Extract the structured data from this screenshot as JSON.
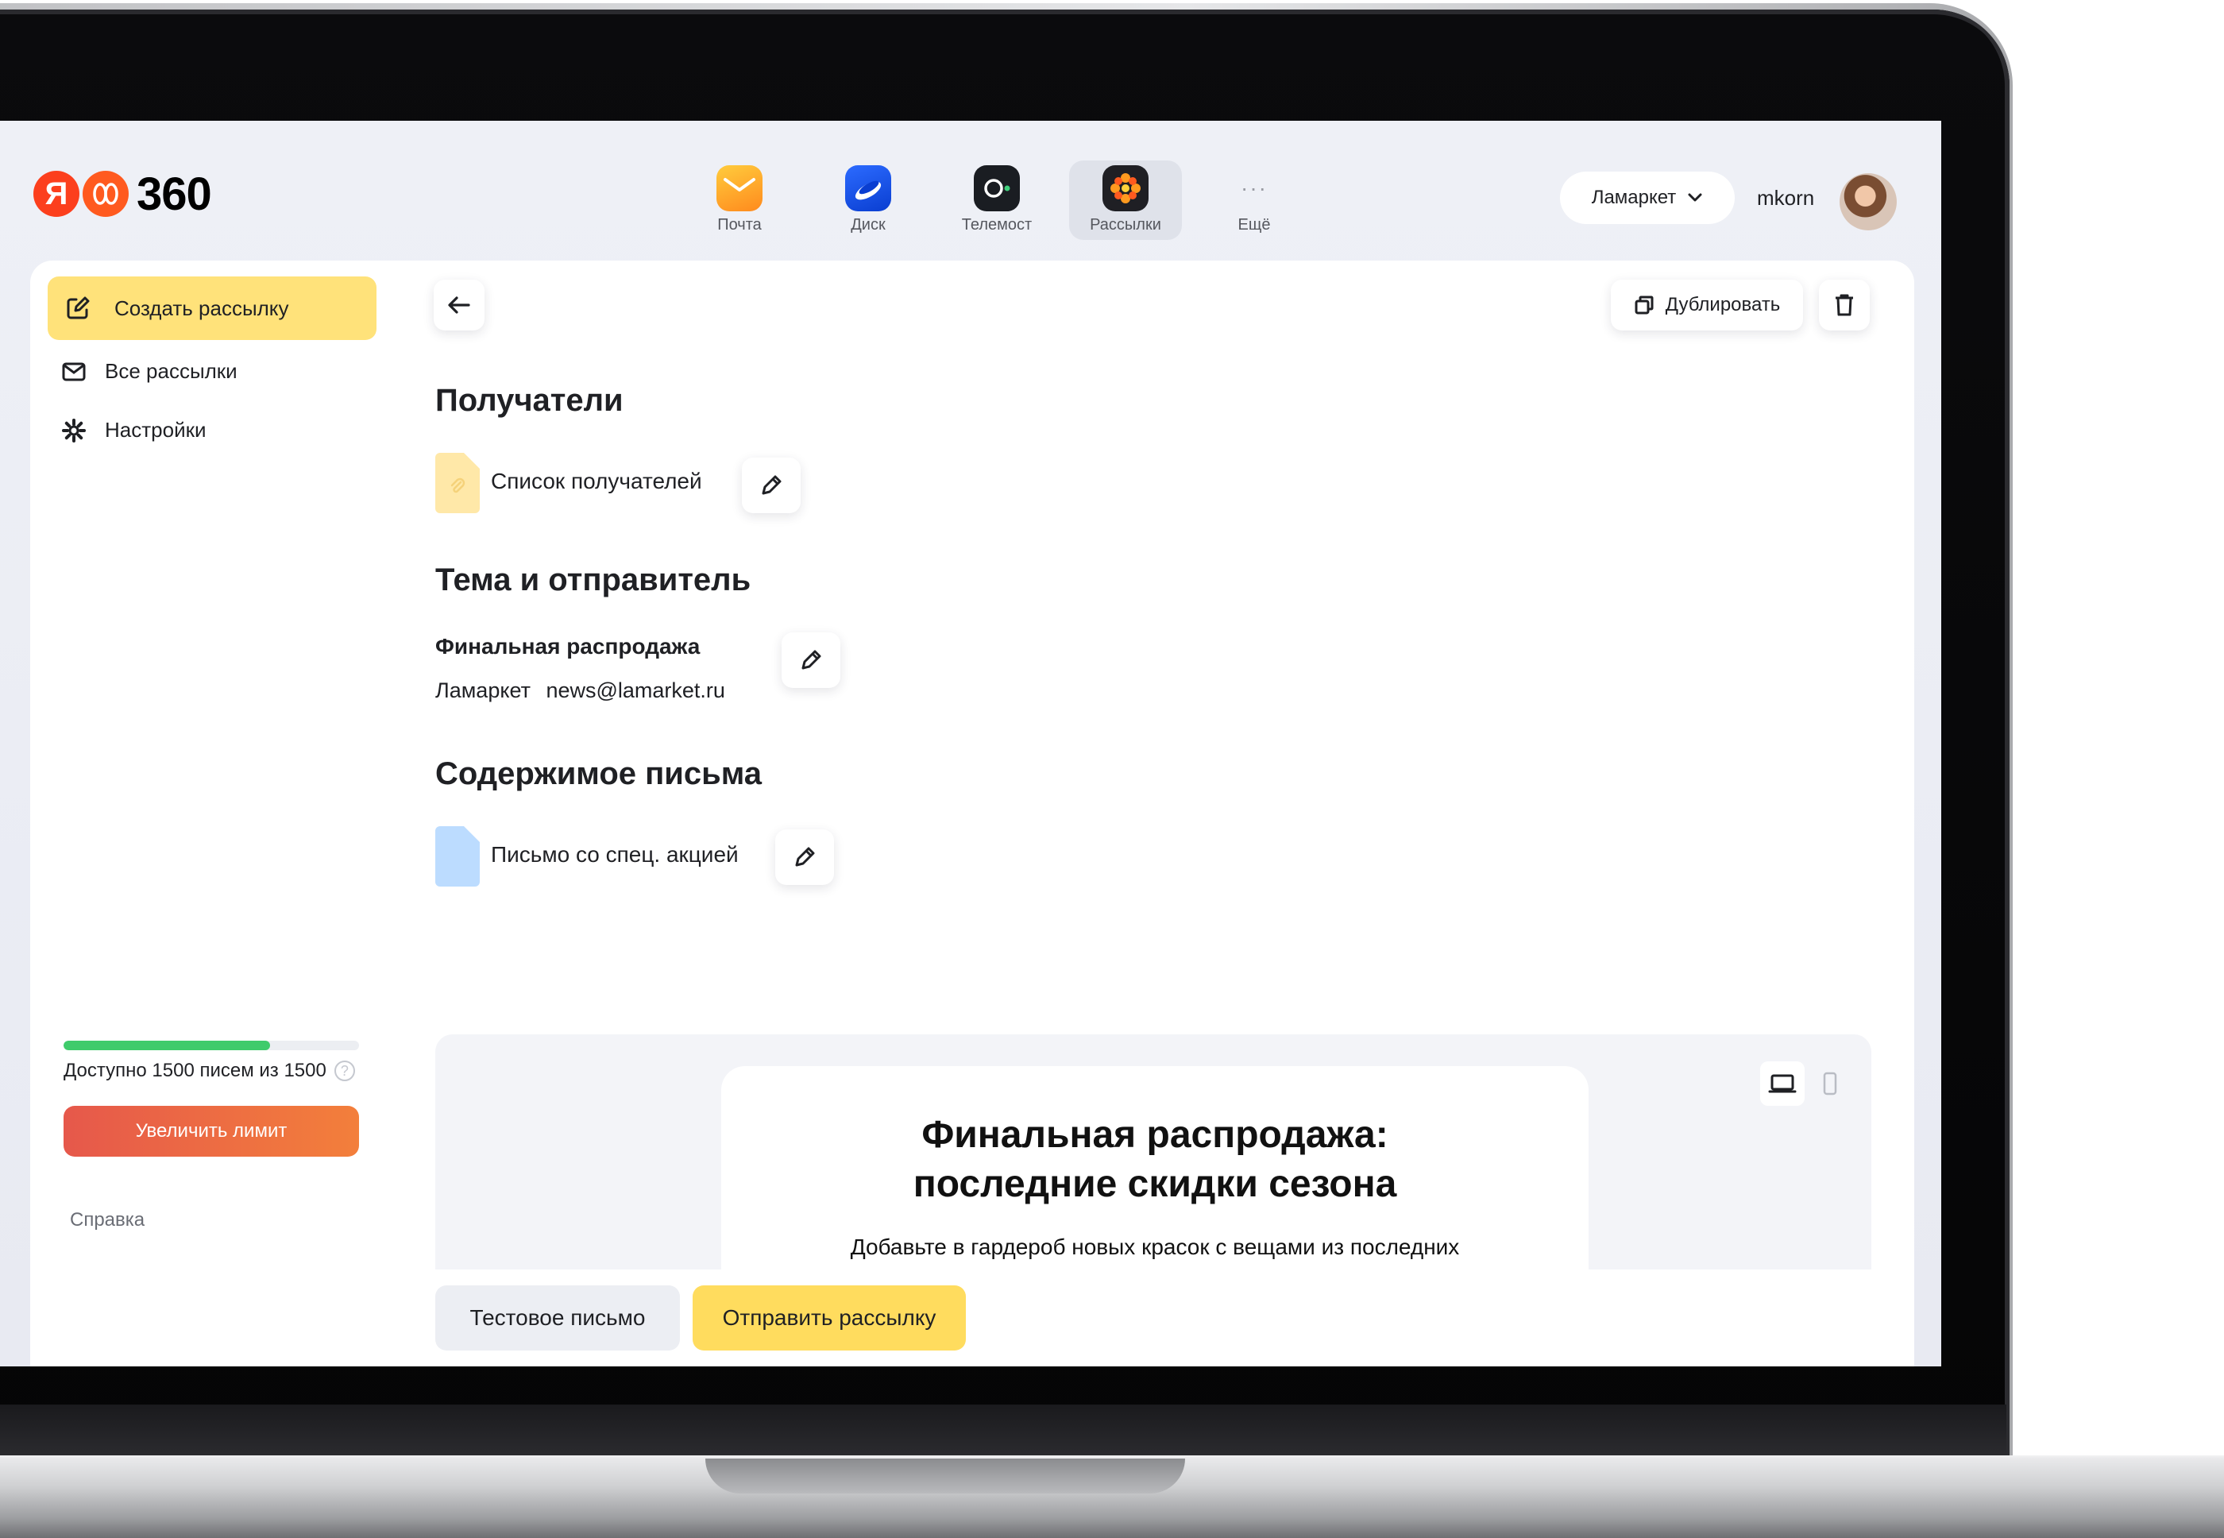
{
  "brand": {
    "logo_letter": "Я",
    "logo_text": "360"
  },
  "apps": [
    {
      "label": "Почта",
      "icon": "mail-icon"
    },
    {
      "label": "Диск",
      "icon": "disk-icon"
    },
    {
      "label": "Телемост",
      "icon": "telemost-icon"
    },
    {
      "label": "Рассылки",
      "icon": "mailings-icon",
      "active": true
    },
    {
      "label": "Ещё",
      "icon": "more-icon"
    }
  ],
  "header": {
    "org": "Ламаркет",
    "user": "mkorn"
  },
  "sidebar": {
    "create_label": "Создать рассылку",
    "items": [
      {
        "label": "Все рассылки",
        "icon": "envelope-icon"
      },
      {
        "label": "Настройки",
        "icon": "gear-icon"
      }
    ],
    "limit_text": "Доступно 1500 писем из 1500",
    "limit_fraction": 0.7,
    "limit_button": "Увеличить лимит",
    "help": "Справка"
  },
  "toolbar": {
    "duplicate_label": "Дублировать"
  },
  "recipients": {
    "heading": "Получатели",
    "list_name": "Список получателей"
  },
  "subject": {
    "heading": "Тема и отправитель",
    "title": "Финальная распродажа",
    "sender_name": "Ламаркет",
    "sender_email": "news@lamarket.ru"
  },
  "content": {
    "heading": "Содержимое письма",
    "letter_name": "Письмо со спец. акцией",
    "preview_title_line1": "Финальная распродажа:",
    "preview_title_line2": "последние скидки сезона",
    "preview_text": "Добавьте в гардероб новых красок с вещами из последних"
  },
  "actions": {
    "test_label": "Тестовое письмо",
    "send_label": "Отправить рассылку"
  },
  "colors": {
    "accent_yellow": "#ffe27a",
    "send_yellow": "#ffdc5e",
    "progress_green": "#3fcb6b",
    "limit_gradient_start": "#e6584b",
    "limit_gradient_end": "#f37f3b"
  }
}
